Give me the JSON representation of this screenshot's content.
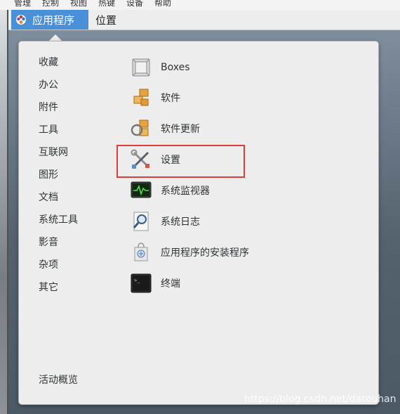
{
  "vm_menubar": {
    "items": [
      "管理",
      "控制",
      "视图",
      "热键",
      "设备",
      "帮助"
    ]
  },
  "top_panel": {
    "applications_label": "应用程序",
    "places_label": "位置"
  },
  "menu": {
    "categories": [
      "收藏",
      "办公",
      "附件",
      "工具",
      "互联网",
      "图形",
      "文档",
      "系统工具",
      "影音",
      "杂项",
      "其它"
    ],
    "activities_label": "活动概览",
    "apps": [
      {
        "label": "Boxes",
        "icon": "boxes-icon"
      },
      {
        "label": "软件",
        "icon": "software-icon"
      },
      {
        "label": "软件更新",
        "icon": "software-update-icon"
      },
      {
        "label": "设置",
        "icon": "settings-icon"
      },
      {
        "label": "系统监视器",
        "icon": "system-monitor-icon"
      },
      {
        "label": "系统日志",
        "icon": "system-log-icon"
      },
      {
        "label": "应用程序的安装程序",
        "icon": "app-installer-icon"
      },
      {
        "label": "终端",
        "icon": "terminal-icon"
      }
    ],
    "highlighted_app": "设置",
    "highlight_color": "#e03b3b"
  },
  "watermark": "https://blog.csdn.net/datouhan"
}
